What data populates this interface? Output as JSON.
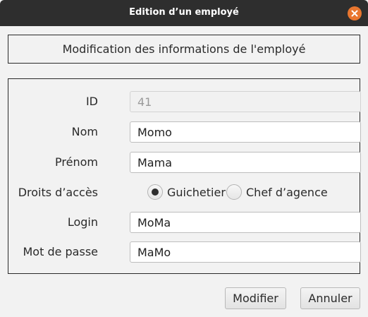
{
  "window": {
    "title": "Edition d’un employé"
  },
  "header": {
    "text": "Modification des informations de l'employé"
  },
  "form": {
    "id": {
      "label": "ID",
      "value": "41"
    },
    "nom": {
      "label": "Nom",
      "value": "Momo"
    },
    "prenom": {
      "label": "Prénom",
      "value": "Mama"
    },
    "droits": {
      "label": "Droits d’accès",
      "options": [
        "Guichetier",
        "Chef d’agence"
      ],
      "selected": "Guichetier"
    },
    "login": {
      "label": "Login",
      "value": "MoMa"
    },
    "password": {
      "label": "Mot de passe",
      "value": "MaMo"
    }
  },
  "buttons": {
    "modifier": "Modifier",
    "annuler": "Annuler"
  },
  "colors": {
    "titlebar": "#2e2e2e",
    "close_button": "#e9762f",
    "background": "#f2f2f2"
  },
  "icons": {
    "close": "close-icon"
  }
}
